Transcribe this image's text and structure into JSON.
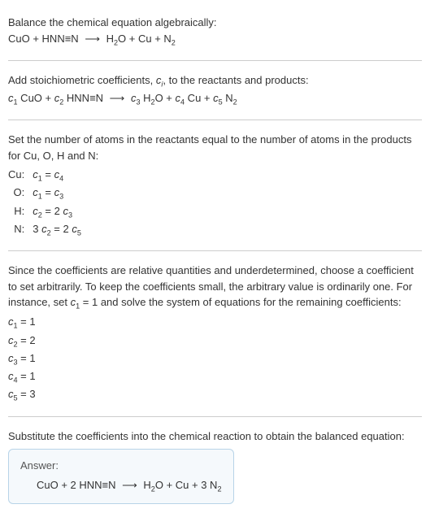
{
  "section1": {
    "line1": "Balance the chemical equation algebraically:",
    "eq_left": "CuO + HNN≡N",
    "eq_arrow": "⟶",
    "eq_right_h2o": "H",
    "eq_right_h2o_sub": "2",
    "eq_right_h2o_o": "O + Cu + N",
    "eq_right_n2_sub": "2"
  },
  "section2": {
    "line1a": "Add stoichiometric coefficients, ",
    "line1b": "c",
    "line1c": "i",
    "line1d": ", to the reactants and products:",
    "c1": "c",
    "c1sub": "1",
    "cuo": " CuO + ",
    "c2": "c",
    "c2sub": "2",
    "hnn": " HNN≡N ",
    "arrow": "⟶",
    "sp": " ",
    "c3": "c",
    "c3sub": "3",
    "h": " H",
    "h2sub": "2",
    "o_plus": "O + ",
    "c4": "c",
    "c4sub": "4",
    "cu_plus": " Cu + ",
    "c5": "c",
    "c5sub": "5",
    "n": " N",
    "n2sub": "2"
  },
  "section3": {
    "line1": "Set the number of atoms in the reactants equal to the number of atoms in the products for Cu, O, H and N:",
    "rows": {
      "cu_label": "Cu:",
      "cu_c1": "c",
      "cu_c1sub": "1",
      "cu_eq": " = ",
      "cu_c4": "c",
      "cu_c4sub": "4",
      "o_label": "O:",
      "o_c1": "c",
      "o_c1sub": "1",
      "o_eq": " = ",
      "o_c3": "c",
      "o_c3sub": "3",
      "h_label": "H:",
      "h_c2": "c",
      "h_c2sub": "2",
      "h_eq": " = 2 ",
      "h_c3": "c",
      "h_c3sub": "3",
      "n_label": "N:",
      "n_3": "3 ",
      "n_c2": "c",
      "n_c2sub": "2",
      "n_eq": " = 2 ",
      "n_c5": "c",
      "n_c5sub": "5"
    }
  },
  "section4": {
    "line1a": "Since the coefficients are relative quantities and underdetermined, choose a coefficient to set arbitrarily. To keep the coefficients small, the arbitrary value is ordinarily one. For instance, set ",
    "line1b": "c",
    "line1c": "1",
    "line1d": " = 1 and solve the system of equations for the remaining coefficients:",
    "c1": "c",
    "c1sub": "1",
    "c1val": " = 1",
    "c2": "c",
    "c2sub": "2",
    "c2val": " = 2",
    "c3": "c",
    "c3sub": "3",
    "c3val": " = 1",
    "c4": "c",
    "c4sub": "4",
    "c4val": " = 1",
    "c5": "c",
    "c5sub": "5",
    "c5val": " = 3"
  },
  "section5": {
    "line1": "Substitute the coefficients into the chemical reaction to obtain the balanced equation:",
    "answer_label": "Answer:",
    "eq_left": "CuO + 2 HNN≡N ",
    "eq_arrow": "⟶",
    "eq_h": " H",
    "eq_h2sub": "2",
    "eq_mid": "O + Cu + 3 N",
    "eq_n2sub": "2"
  }
}
